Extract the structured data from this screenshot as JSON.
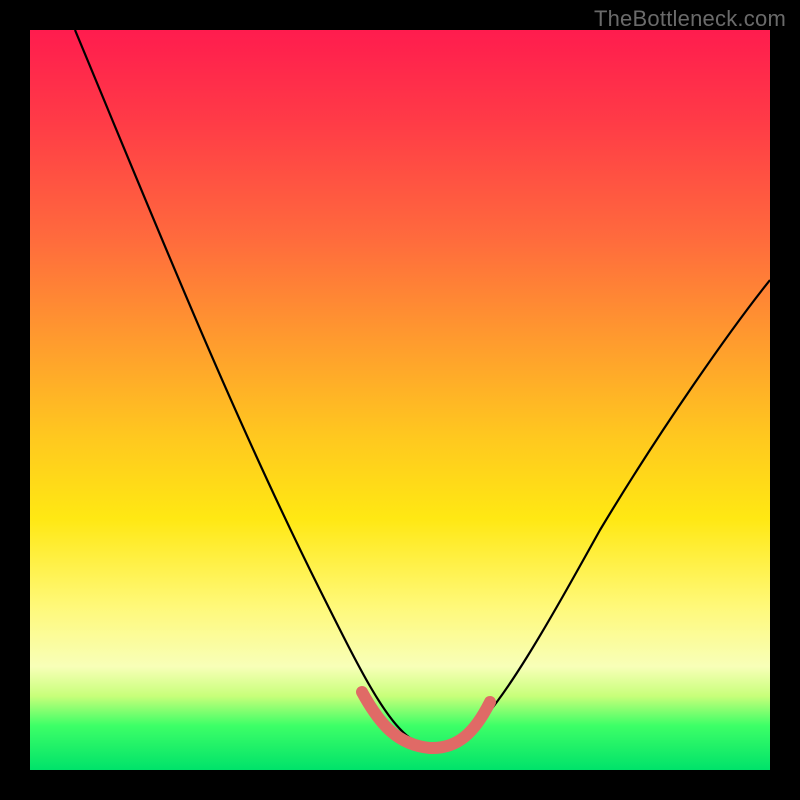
{
  "attribution": "TheBottleneck.com",
  "chart_data": {
    "type": "line",
    "title": "",
    "xlabel": "",
    "ylabel": "",
    "xlim": [
      0,
      100
    ],
    "ylim": [
      0,
      100
    ],
    "gradient_stops": [
      {
        "pos": 0,
        "color": "#ff1c4e"
      },
      {
        "pos": 28,
        "color": "#ff6a3d"
      },
      {
        "pos": 55,
        "color": "#ffc81f"
      },
      {
        "pos": 78,
        "color": "#fff97a"
      },
      {
        "pos": 94,
        "color": "#3dff67"
      },
      {
        "pos": 100,
        "color": "#00e26a"
      }
    ],
    "series": [
      {
        "name": "main-curve",
        "color": "#000000",
        "x": [
          0,
          5,
          10,
          15,
          20,
          25,
          30,
          35,
          40,
          45,
          48,
          52,
          55,
          58,
          63,
          68,
          74,
          80,
          86,
          92,
          100
        ],
        "y": [
          100,
          90,
          80,
          69,
          58,
          47,
          36,
          26,
          16,
          7,
          3,
          1,
          1,
          3,
          9,
          16,
          24,
          32,
          40,
          47,
          56
        ]
      },
      {
        "name": "valley-highlight",
        "color": "#e56a66",
        "x": [
          44,
          46,
          48,
          50,
          52,
          54,
          56,
          58,
          60
        ],
        "y": [
          8,
          5,
          3,
          2,
          1.5,
          1.5,
          2,
          3,
          5
        ]
      }
    ]
  }
}
